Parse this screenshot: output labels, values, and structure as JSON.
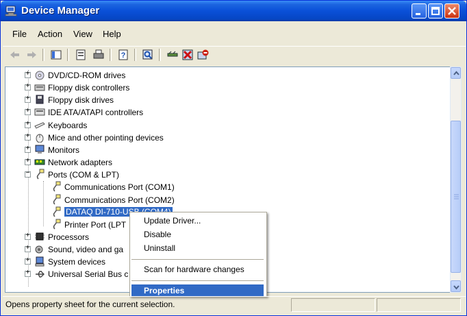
{
  "window": {
    "title": "Device Manager"
  },
  "menu": [
    "File",
    "Action",
    "View",
    "Help"
  ],
  "toolbar": {
    "buttons": [
      "back-icon",
      "forward-icon",
      "show-hide-tree-icon",
      "properties-icon",
      "print-icon",
      "help-icon",
      "scan-hardware-icon",
      "update-driver-icon",
      "uninstall-icon",
      "disable-icon"
    ]
  },
  "tree": {
    "nodes": [
      {
        "label": "DVD/CD-ROM drives",
        "icon": "cdrom-icon",
        "level": 0,
        "expander": "+"
      },
      {
        "label": "Floppy disk controllers",
        "icon": "disk-controller-icon",
        "level": 0,
        "expander": "+"
      },
      {
        "label": "Floppy disk drives",
        "icon": "floppy-icon",
        "level": 0,
        "expander": "+"
      },
      {
        "label": "IDE ATA/ATAPI controllers",
        "icon": "ide-controller-icon",
        "level": 0,
        "expander": "+"
      },
      {
        "label": "Keyboards",
        "icon": "keyboard-icon",
        "level": 0,
        "expander": "+"
      },
      {
        "label": "Mice and other pointing devices",
        "icon": "mouse-icon",
        "level": 0,
        "expander": "+"
      },
      {
        "label": "Monitors",
        "icon": "monitor-icon",
        "level": 0,
        "expander": "+"
      },
      {
        "label": "Network adapters",
        "icon": "network-adapter-icon",
        "level": 0,
        "expander": "+"
      },
      {
        "label": "Ports (COM & LPT)",
        "icon": "port-icon",
        "level": 0,
        "expander": "-"
      },
      {
        "label": "Communications Port (COM1)",
        "icon": "port-icon",
        "level": 1
      },
      {
        "label": "Communications Port (COM2)",
        "icon": "port-icon",
        "level": 1
      },
      {
        "label": "DATAQ DI-710-USB (COM4)",
        "icon": "port-icon",
        "level": 1,
        "selected": true
      },
      {
        "label": "Printer Port (LPT",
        "icon": "port-icon",
        "level": 1
      },
      {
        "label": "Processors",
        "icon": "processor-icon",
        "level": 0,
        "expander": "+"
      },
      {
        "label": "Sound, video and ga",
        "icon": "sound-icon",
        "level": 0,
        "expander": "+"
      },
      {
        "label": "System devices",
        "icon": "system-devices-icon",
        "level": 0,
        "expander": "+"
      },
      {
        "label": "Universal Serial Bus c",
        "icon": "usb-icon",
        "level": 0,
        "expander": "+"
      }
    ]
  },
  "context_menu": {
    "items": [
      {
        "label": "Update Driver...",
        "name": "update-driver"
      },
      {
        "label": "Disable",
        "name": "disable"
      },
      {
        "label": "Uninstall",
        "name": "uninstall"
      },
      {
        "separator": true
      },
      {
        "label": "Scan for hardware changes",
        "name": "scan-hardware-changes"
      },
      {
        "separator": true
      },
      {
        "label": "Properties",
        "name": "properties",
        "highlighted": true
      }
    ]
  },
  "status": {
    "text": "Opens property sheet for the current selection."
  },
  "colors": {
    "selection": "#316ac5",
    "titlebar": "#0a50d8",
    "face": "#ece9d8"
  }
}
